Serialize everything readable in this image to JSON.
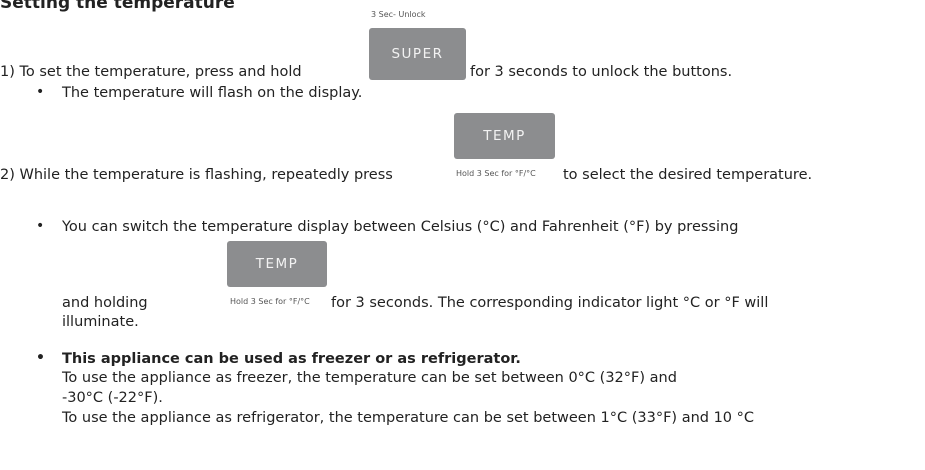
{
  "heading": "Setting the temperature",
  "super_caption": "3 Sec- Unlock",
  "super_label": "SUPER",
  "temp_label": "TEMP",
  "temp_caption": "Hold 3 Sec for °F/°C",
  "step1": {
    "prefix": "1) To set the temperature, press and hold",
    "suffix": "for 3 seconds to unlock the buttons.",
    "bullet": "The temperature will flash on the display."
  },
  "step2": {
    "prefix": "2) While the temperature is flashing, repeatedly press",
    "suffix": "to select the desired temperature."
  },
  "bullet_switch": {
    "line1": "You can switch the temperature display between Celsius (°C) and Fahrenheit (°F) by pressing",
    "line2_prefix": "and holding",
    "line2_suffix": "for 3 seconds. The corresponding indicator light °C or °F will",
    "line3": "illuminate."
  },
  "bullet_freezer": {
    "title": "This appliance can be used as freezer or as refrigerator.",
    "line1": "To use the appliance as freezer, the temperature can be set between 0°C (32°F) and",
    "line2": "-30°C (-22°F).",
    "line3": "To use the appliance as refrigerator, the temperature can be set between 1°C (33°F) and 10 °C"
  }
}
